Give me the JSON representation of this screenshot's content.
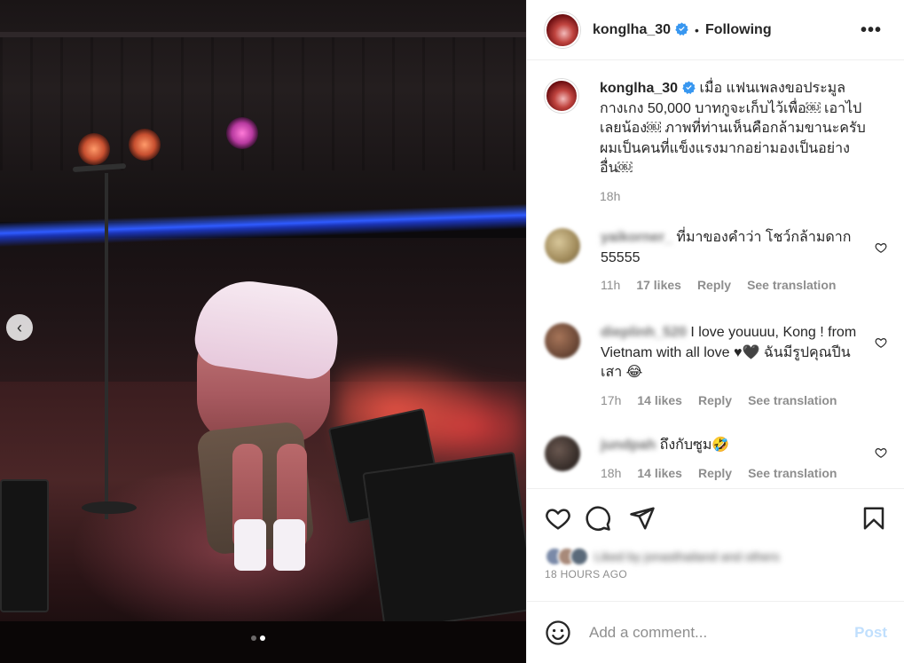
{
  "post": {
    "username": "konglha_30",
    "following_label": "Following",
    "separator": "•",
    "more_label": "•••",
    "caption_text": "เมื่อ แฟนเพลงขอประมูลกางเกง 50,000 บาทกูจะเก็บไว้เพื่อ￼ เอาไปเลยน้อง￼ ภาพที่ท่านเห็นคือกล้ามขานะครับผมเป็นคนที่แข็งแรงมากอย่ามองเป็นอย่างอื่น￼",
    "caption_time": "18h",
    "time_ago": "18 HOURS AGO",
    "liked_by_text": "Liked by jonasthailand and others"
  },
  "media": {
    "prev_icon": "‹",
    "slide_count": 2,
    "active_slide": 2
  },
  "comments": [
    {
      "username": "yaikorner_",
      "text": "ที่มาของคำว่า โชว์กล้ามดาก 55555",
      "time": "11h",
      "likes": "17 likes",
      "reply": "Reply",
      "translate": "See translation",
      "avatar_color": "#b9a47a"
    },
    {
      "username": "dieplinh_520",
      "text": "I love youuuu, Kong ! from Vietnam with all love ♥🖤 ฉันมีรูปคุณปีนเสา 😂",
      "time": "17h",
      "likes": "14 likes",
      "reply": "Reply",
      "translate": "See translation",
      "avatar_color": "#6e4a38"
    },
    {
      "username": "jundpah",
      "text": "ถึงกับซูม🤣",
      "time": "18h",
      "likes": "14 likes",
      "reply": "Reply",
      "translate": "See translation",
      "avatar_color": "#3a302c"
    }
  ],
  "composer": {
    "placeholder": "Add a comment...",
    "post_label": "Post"
  },
  "icons": {
    "like": "heart-icon",
    "comment": "comment-bubble-icon",
    "share": "paper-plane-icon",
    "save": "bookmark-icon",
    "emoji": "smiley-icon",
    "verified": "verified-badge-icon"
  },
  "colors": {
    "verified_blue": "#3897f0",
    "post_disabled": "#c0dffd",
    "secondary_text": "#8e8e8e"
  }
}
